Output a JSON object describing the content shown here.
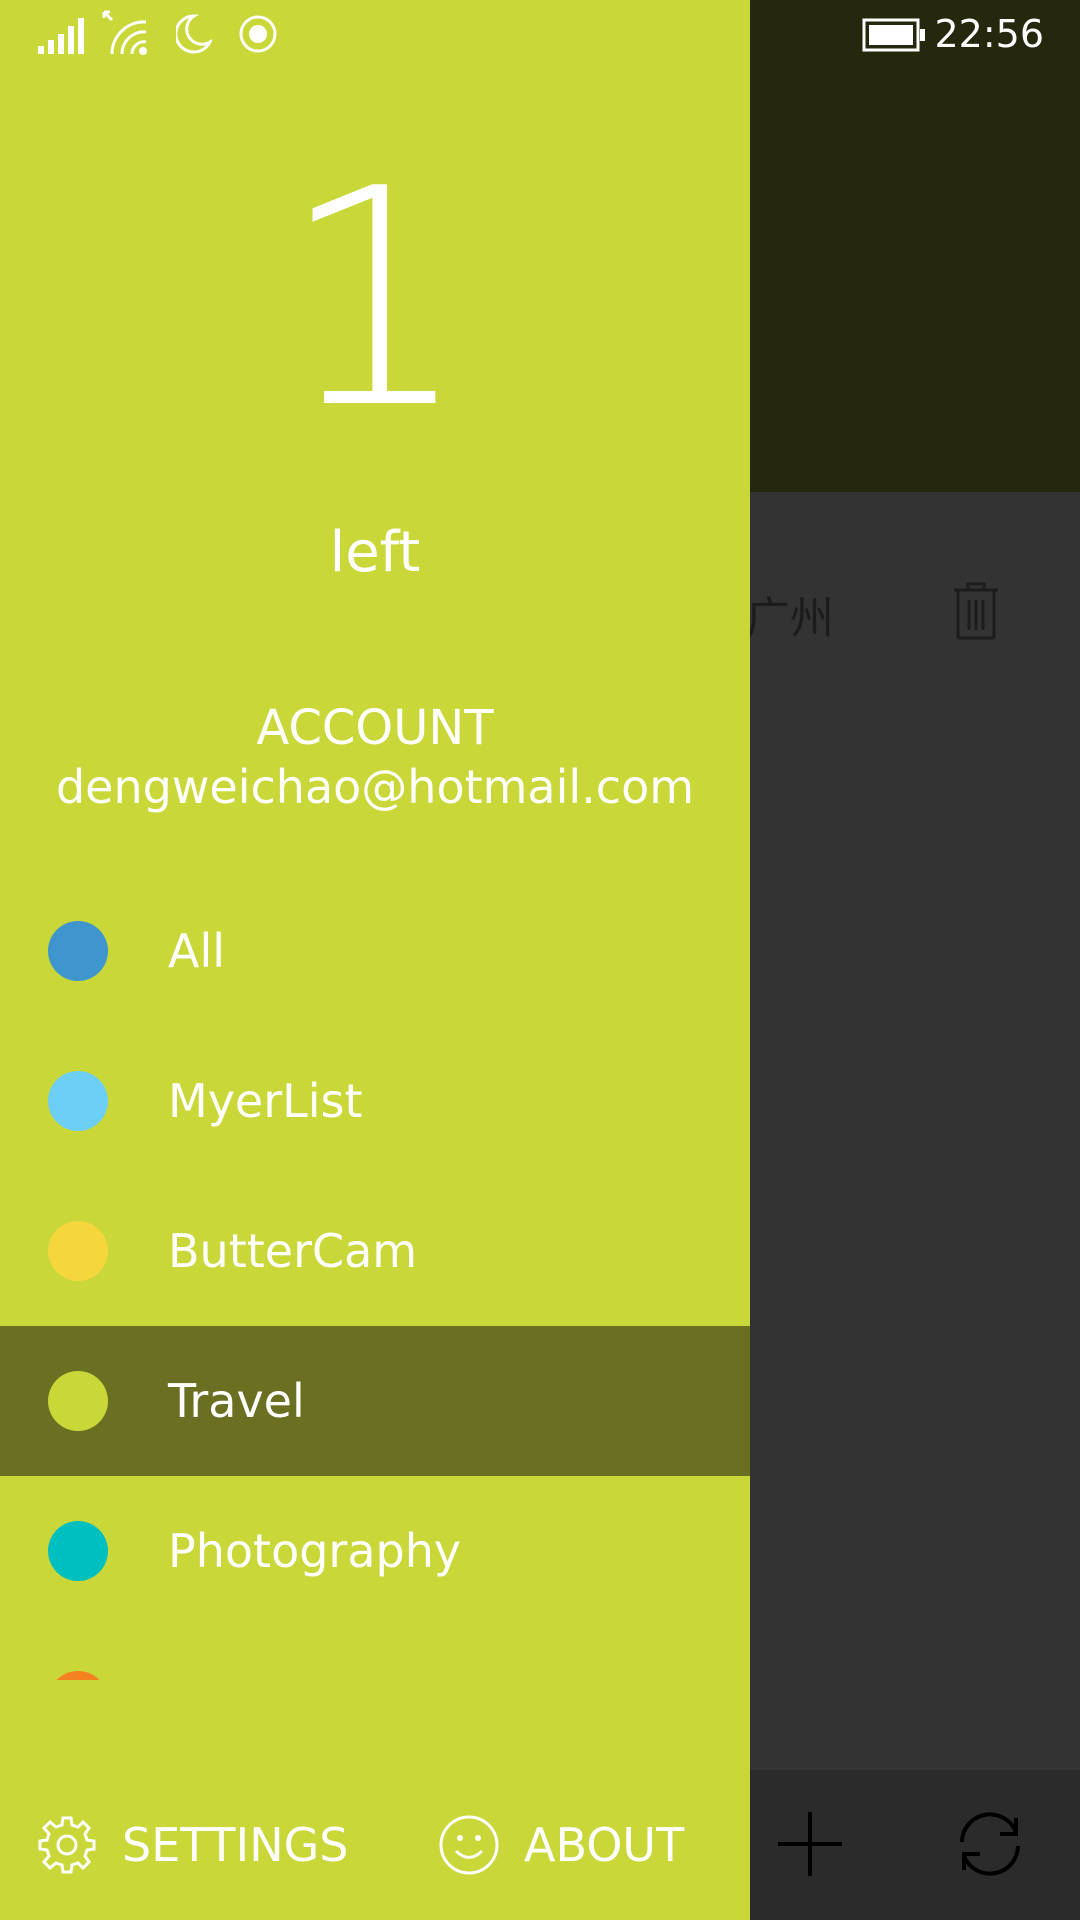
{
  "status_bar": {
    "time": "22:56",
    "icons": [
      "signal-icon",
      "wifi-icon",
      "quiet-hours-moon-icon",
      "location-icon",
      "battery-icon"
    ]
  },
  "drawer": {
    "count": "1",
    "count_label": "left",
    "account_heading": "ACCOUNT",
    "account_email": "dengweichao@hotmail.com",
    "categories": [
      {
        "label": "All",
        "color": "#3f95cd"
      },
      {
        "label": "MyerList",
        "color": "#6ecff6"
      },
      {
        "label": "ButterCam",
        "color": "#f5d63d"
      },
      {
        "label": "Travel",
        "color": "#c9d739",
        "selected": true
      },
      {
        "label": "Photography",
        "color": "#00bfbf"
      },
      {
        "label": "",
        "color": "#f58220"
      }
    ],
    "footer": {
      "settings_label": "SETTINGS",
      "about_label": "ABOUT"
    }
  },
  "background_page": {
    "item_text": "-广州",
    "header_color": "#25280d"
  },
  "theme": {
    "drawer_color": "#c9d739",
    "selected_color": "#6a6f21",
    "page_color": "#333333"
  }
}
